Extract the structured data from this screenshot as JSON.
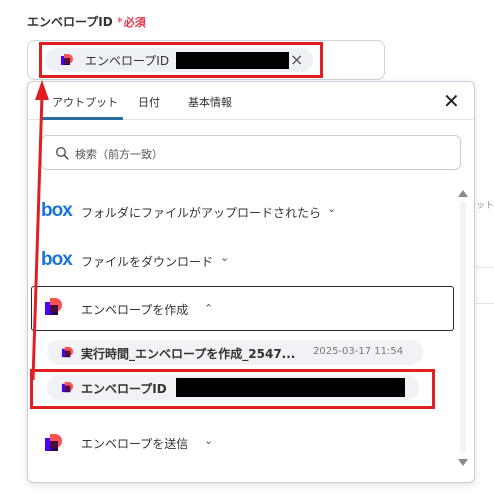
{
  "field": {
    "label": "エンベロープID",
    "required_star": "*",
    "required_text": "必須",
    "chip_label": "エンベロープID",
    "clear_glyph": "×"
  },
  "panel": {
    "tabs": [
      {
        "label": "アウトプット",
        "active": true
      },
      {
        "label": "日付",
        "active": false
      },
      {
        "label": "基本情報",
        "active": false
      }
    ],
    "close_glyph": "✕",
    "search_placeholder": "検索（前方一致）",
    "rows": [
      {
        "label": "フォルダにファイルがアップロードされたら",
        "icon": "box-logo",
        "chevron": "⌄"
      },
      {
        "label": "ファイルをダウンロード",
        "icon": "box-logo",
        "chevron": "⌄"
      },
      {
        "label": "エンベロープを作成",
        "icon": "docusign-logo",
        "chevron": "⌃",
        "expanded": true
      },
      {
        "label": "エンベロープを送信",
        "icon": "docusign-logo",
        "chevron": "⌄"
      }
    ],
    "outputs": [
      {
        "name": "実行時間_エンベロープを作成_2547...",
        "value": "2025-03-17 11:54"
      },
      {
        "name": "エンベロープID",
        "value": ""
      }
    ]
  },
  "box_logo_text": "box",
  "background_fragment": "ットに",
  "colors": {
    "required": "#e4344a",
    "highlight": "#e02020",
    "tab_active": "#2a6e9e",
    "box_brand": "#1b74d8"
  }
}
